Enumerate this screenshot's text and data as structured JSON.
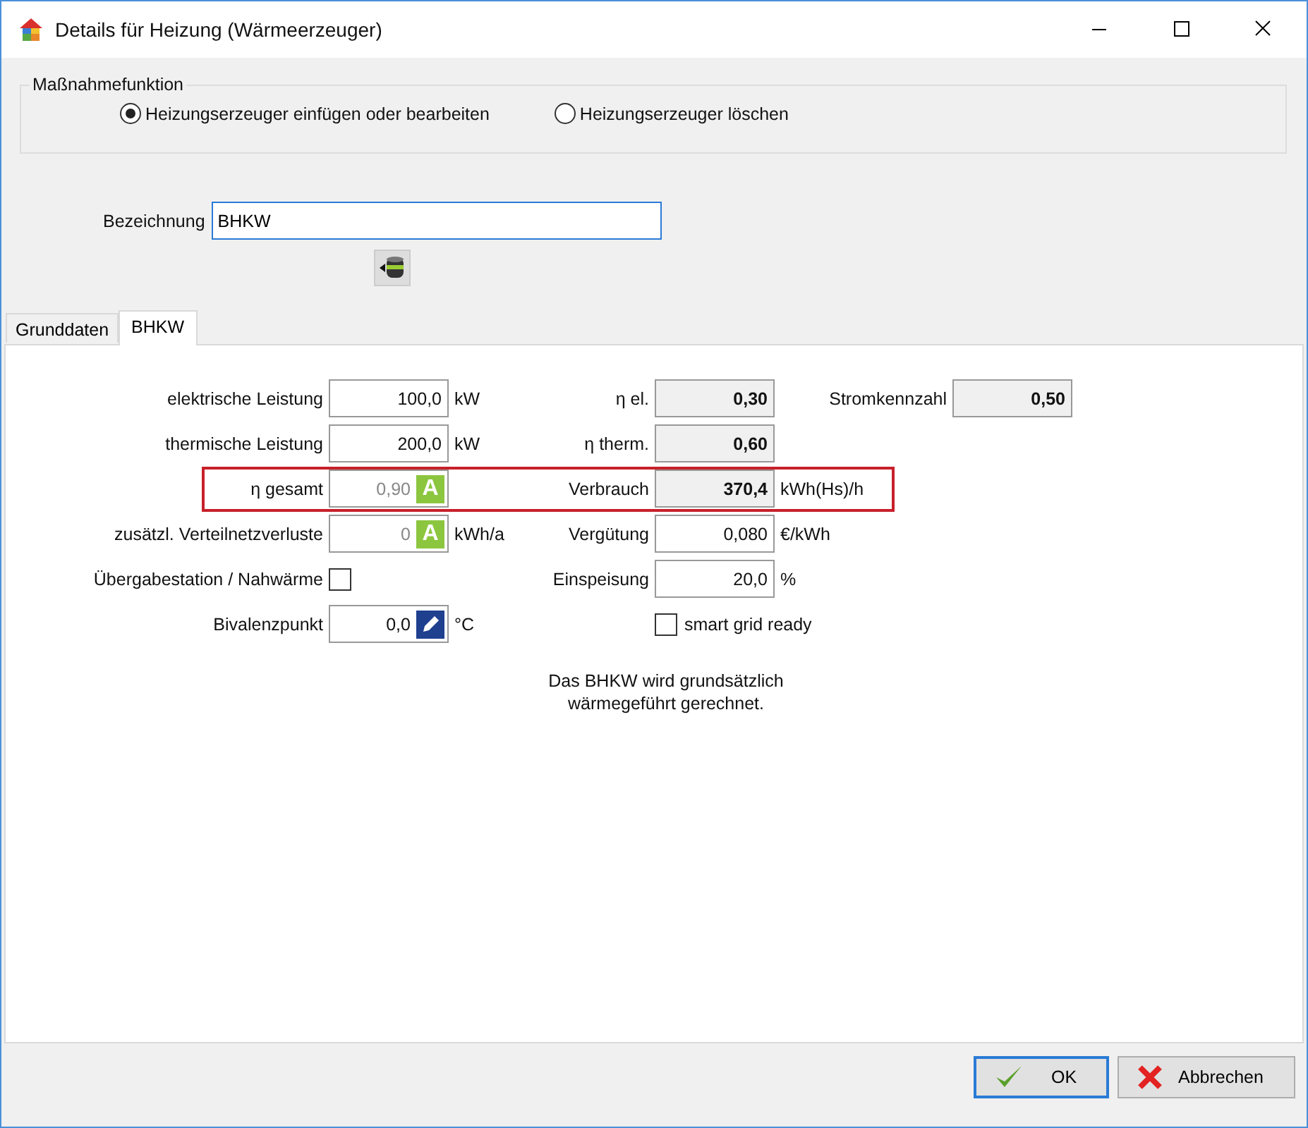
{
  "window": {
    "title": "Details für Heizung  (Wärmeerzeuger)"
  },
  "measure_group": {
    "title": "Maßnahmefunktion",
    "options": [
      {
        "label": "Heizungserzeuger einfügen oder bearbeiten",
        "selected": true
      },
      {
        "label": "Heizungserzeuger löschen",
        "selected": false
      }
    ]
  },
  "name_field": {
    "label": "Bezeichnung",
    "value": "BHKW"
  },
  "tabs": [
    {
      "label": "Grunddaten",
      "selected": false
    },
    {
      "label": "BHKW",
      "selected": true
    }
  ],
  "rows": [
    {
      "left": {
        "kind": "input",
        "label": "elektrische Leistung",
        "value": "100,0",
        "unit": "kW"
      },
      "right": {
        "kind": "readonly",
        "label": "η el.",
        "value": "0,30"
      },
      "extra": {
        "label": "Stromkennzahl",
        "value": "0,50"
      }
    },
    {
      "left": {
        "kind": "input",
        "label": "thermische Leistung",
        "value": "200,0",
        "unit": "kW"
      },
      "right": {
        "kind": "readonly",
        "label": "η therm.",
        "value": "0,60"
      }
    },
    {
      "highlighted": true,
      "left": {
        "kind": "auto",
        "label": "η gesamt",
        "value": "0,90",
        "badge": "A"
      },
      "right": {
        "kind": "readonly",
        "label": "Verbrauch",
        "value": "370,4",
        "unit": "kWh(Hs)/h"
      }
    },
    {
      "left": {
        "kind": "auto",
        "label": "zusätzl. Verteilnetzverluste",
        "value": "0",
        "badge": "A",
        "unit": "kWh/a"
      },
      "right": {
        "kind": "input",
        "label": "Vergütung",
        "value": "0,080",
        "unit": "€/kWh"
      }
    },
    {
      "left": {
        "kind": "checkbox",
        "label": "Übergabestation / Nahwärme",
        "checked": false
      },
      "right": {
        "kind": "input",
        "label": "Einspeisung",
        "value": "20,0",
        "unit": "%"
      }
    },
    {
      "left": {
        "kind": "edit",
        "label": "Bivalenzpunkt",
        "value": "0,0",
        "unit": "°C"
      },
      "right": {
        "kind": "checkbox",
        "label": "smart grid ready",
        "checked": false
      }
    }
  ],
  "note": [
    "Das BHKW wird grundsätzlich",
    "wärmegeführt gerechnet."
  ],
  "buttons": [
    {
      "label": "OK",
      "kind": "ok",
      "default": true
    },
    {
      "label": "Abbrechen",
      "kind": "cancel",
      "default": false
    }
  ]
}
